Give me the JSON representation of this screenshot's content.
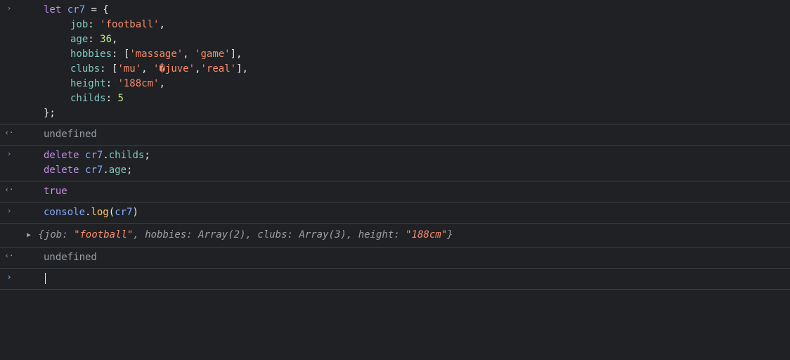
{
  "entries": {
    "input1": {
      "l1": {
        "keyword": "let",
        "var": "cr7",
        "op": " = {"
      },
      "l2": {
        "prop": "job",
        "colon": ": ",
        "val": "'football'",
        "comma": ","
      },
      "l3": {
        "prop": "age",
        "colon": ": ",
        "val": "36",
        "comma": ","
      },
      "l4": {
        "prop": "hobbies",
        "colon": ": [",
        "v1": "'massage'",
        "c1": ", ",
        "v2": "'game'",
        "end": "],"
      },
      "l5": {
        "prop": "clubs",
        "colon": ": [",
        "v1": "'mu'",
        "c1": ", ",
        "v2": "'�juve'",
        "c2": ",",
        "v3": "'real'",
        "end": "],"
      },
      "l6": {
        "prop": "height",
        "colon": ": ",
        "val": "'188cm'",
        "comma": ","
      },
      "l7": {
        "prop": "childs",
        "colon": ": ",
        "val": "5"
      },
      "l8": {
        "text": "};"
      }
    },
    "output1": {
      "val": "undefined"
    },
    "input2": {
      "l1": {
        "kw": "delete",
        "sp": " ",
        "obj": "cr7",
        "dot": ".",
        "prop": "childs",
        "semi": ";"
      },
      "l2": {
        "kw": "delete",
        "sp": " ",
        "obj": "cr7",
        "dot": ".",
        "prop": "age",
        "semi": ";"
      }
    },
    "output2": {
      "val": "true"
    },
    "input3": {
      "obj": "console",
      "dot": ".",
      "method": "log",
      "open": "(",
      "arg": "cr7",
      "close": ")"
    },
    "result3": {
      "open": "{",
      "p1": "job: ",
      "v1": "\"football\"",
      "c1": ", ",
      "p2": "hobbies: ",
      "v2": "Array(2)",
      "c2": ", ",
      "p3": "clubs: ",
      "v3": "Array(3)",
      "c3": ", ",
      "p4": "height: ",
      "v4": "\"188cm\"",
      "close": "}"
    },
    "output3": {
      "val": "undefined"
    }
  },
  "icons": {
    "input": "›",
    "output": "‹·",
    "expand": "▶"
  }
}
